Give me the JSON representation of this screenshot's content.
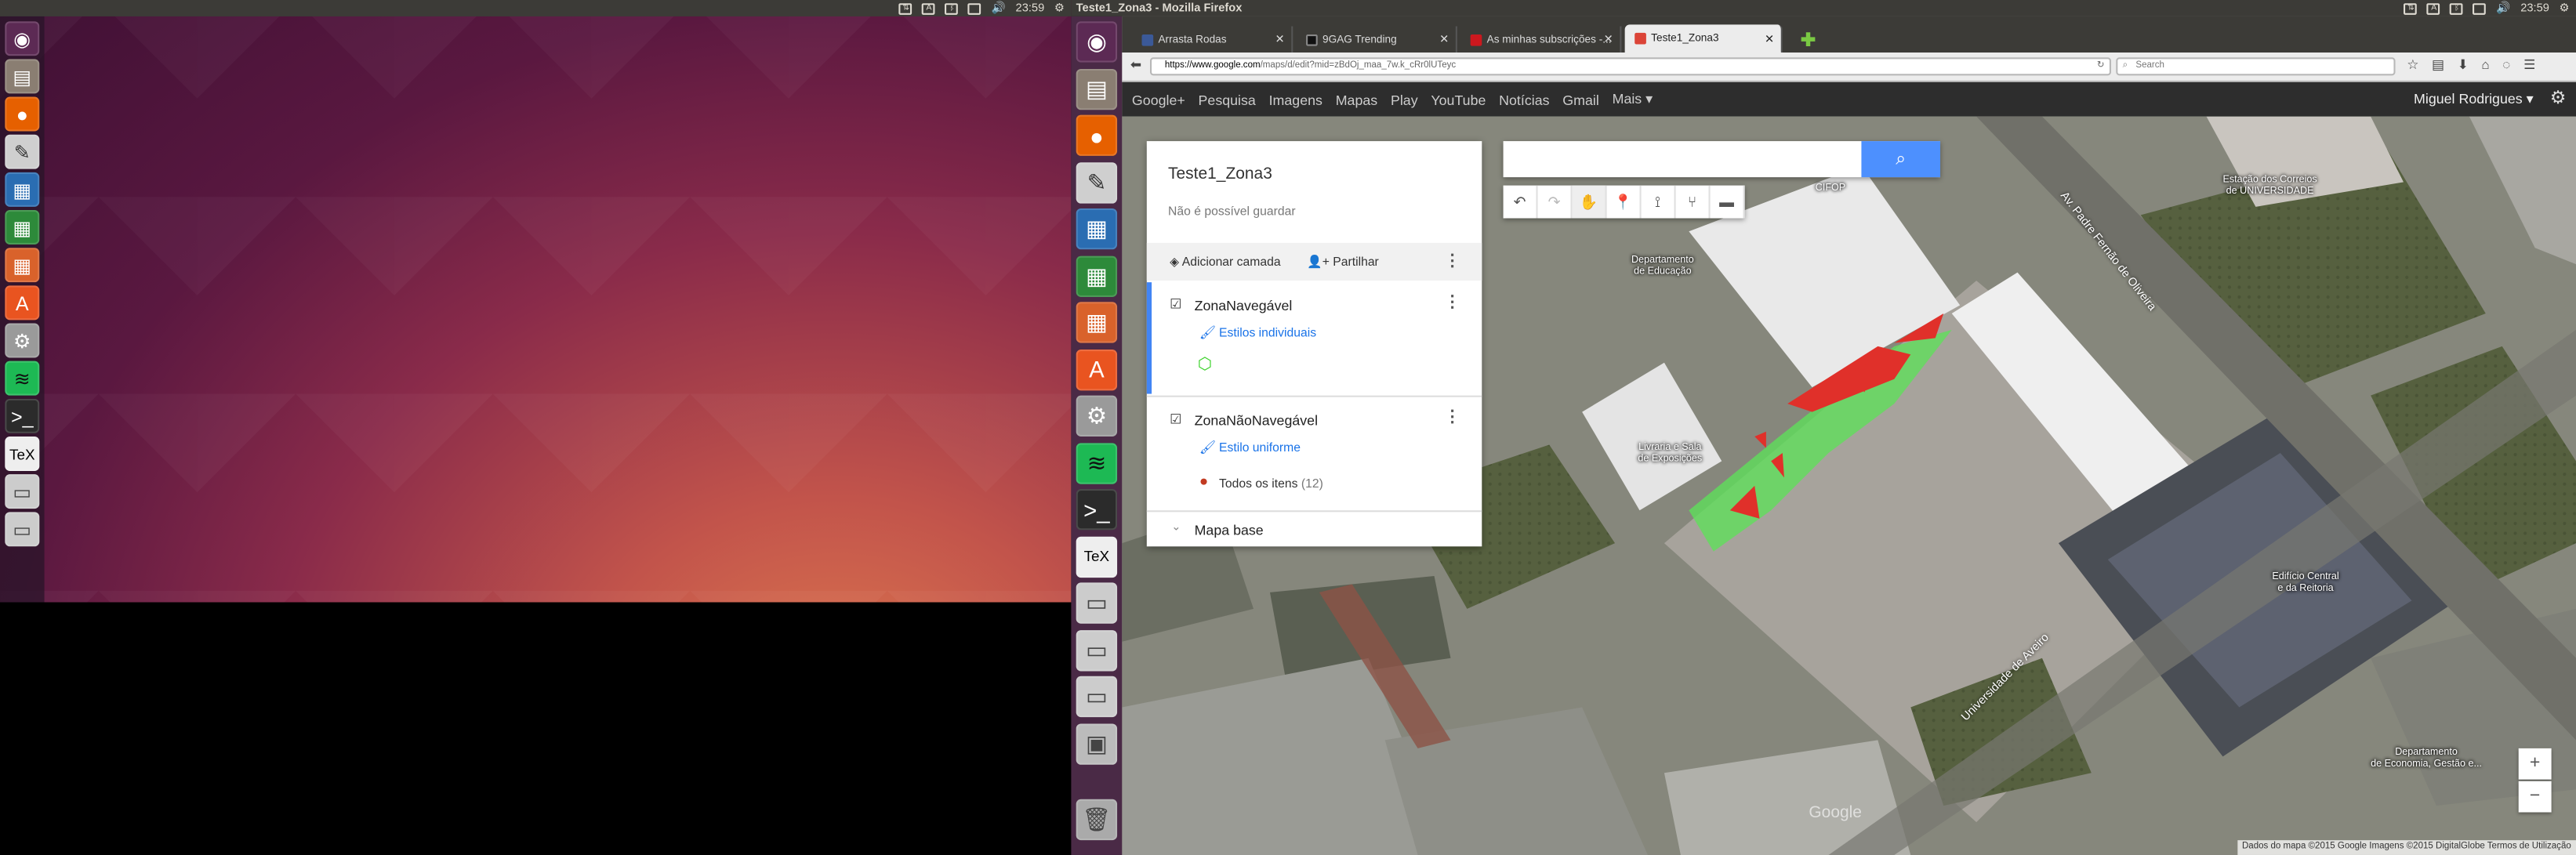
{
  "topbar_left": {
    "time": "23:59"
  },
  "topbar_right": {
    "window_title": "Teste1_Zona3 - Mozilla Firefox",
    "time": "23:59"
  },
  "tabs": [
    {
      "label": "Arrasta Rodas",
      "color": "#3b5998"
    },
    {
      "label": "9GAG Trending",
      "color": "#111111"
    },
    {
      "label": "As minhas subscrições -...",
      "color": "#cc181e"
    },
    {
      "label": "Teste1_Zona3",
      "color": "#db4437"
    }
  ],
  "urlbar": {
    "host": "https://www.google.com",
    "path": "/maps/d/edit?mid=zBdOj_maa_7w.k_cRr0lUTeyc"
  },
  "searchbar": {
    "placeholder": "Search"
  },
  "google_bar": {
    "links": [
      "Google+",
      "Pesquisa",
      "Imagens",
      "Mapas",
      "Play",
      "YouTube",
      "Notícias",
      "Gmail",
      "Mais ▾"
    ],
    "user": "Miguel Rodrigues ▾"
  },
  "panel": {
    "title": "Teste1_Zona3",
    "status": "Não é possível guardar",
    "add_layer": "Adicionar camada",
    "share": "Partilhar",
    "layers": [
      {
        "name": "ZonaNavegável",
        "style": "Estilos individuais"
      },
      {
        "name": "ZonaNãoNavegável",
        "style": "Estilo uniforme",
        "items_label": "Todos os itens",
        "items_count": "(12)"
      }
    ],
    "base_map": "Mapa base"
  },
  "map": {
    "labels": {
      "cifop": "CIFOP",
      "dep_educacao_1": "Departamento",
      "dep_educacao_2": "de Educação",
      "correios_1": "Estação dos Correios",
      "correios_2": "de UNIVERSIDADE",
      "livraria_1": "Livraria e Sala",
      "livraria_2": "de Exposições",
      "reitoria_1": "Edifício Central",
      "reitoria_2": "e da Reitoria",
      "economia_1": "Departamento",
      "economia_2": "de Economia, Gestão e...",
      "road1": "Av. Padre Fernão de Oliveira",
      "road2": "Universidade de Aveiro"
    },
    "watermark": "Google",
    "footer": "Dados do mapa ©2015 Google Imagens ©2015 DigitalGlobe    Termos de Utilização"
  }
}
